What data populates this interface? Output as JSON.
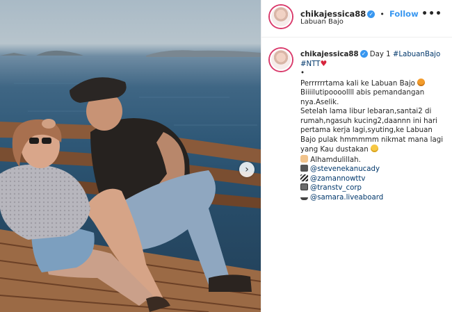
{
  "post": {
    "username": "chikajessica88",
    "verified_icon": "verified-check-icon",
    "separator": "•",
    "follow_label": "Follow",
    "location": "Labuan Bajo",
    "more_icon": "more-options-icon"
  },
  "caption": {
    "username": "chikajessica88",
    "title_text": "Day 1 ",
    "hashtag_1": "#LabuanBajo",
    "hashtag_2": "#NTT",
    "bullet": "•",
    "line_1": "Perrrrrrtama kali ke Labuan Bajo",
    "line_2": "Biiiilutipoooollll abis pemandangan nya.Aselik.",
    "line_3": "Setelah lama libur lebaran,santai2 di rumah,ngasuh kucing2,daannn ini hari pertama kerja lagi,syuting,ke Labuan Bajo pulak hmmmmm nikmat mana lagi yang Kau dustakan",
    "line_4": "Alhamdulillah.",
    "mentions": [
      {
        "icon": "camera-icon",
        "handle": "@stevenekanucady"
      },
      {
        "icon": "clapperboard-icon",
        "handle": "@zamannowttv"
      },
      {
        "icon": "tv-icon",
        "handle": "@transtv_corp"
      },
      {
        "icon": "ship-icon",
        "handle": "@samara.liveaboard"
      }
    ]
  },
  "photo": {
    "next_icon": "chevron-right-icon",
    "next_glyph": "›"
  },
  "colors": {
    "accent": "#3897f0",
    "link": "#00376b",
    "story_ring": "#d93a6b"
  }
}
